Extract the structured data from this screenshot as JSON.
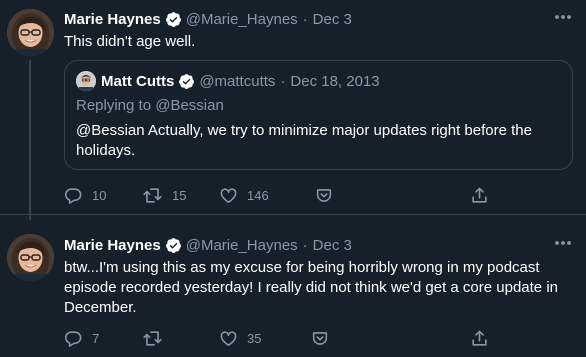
{
  "colors": {
    "background": "#15202b",
    "text": "#ffffff",
    "muted": "#8899a6",
    "border": "#38444d",
    "verified": "#ffffff"
  },
  "tweets": [
    {
      "display_name": "Marie Haynes",
      "handle": "@Marie_Haynes",
      "separator": "·",
      "date": "Dec 3",
      "text": "This didn't age well.",
      "quote": {
        "display_name": "Matt Cutts",
        "handle": "@mattcutts",
        "separator": "·",
        "date": "Dec 18, 2013",
        "replying_to": "Replying to @Bessian",
        "text": "@Bessian Actually, we try to minimize major updates right before the holidays."
      },
      "actions": {
        "reply_count": "10",
        "retweet_count": "15",
        "like_count": "146"
      }
    },
    {
      "display_name": "Marie Haynes",
      "handle": "@Marie_Haynes",
      "separator": "·",
      "date": "Dec 3",
      "text": "btw...I'm using this as my excuse for being horribly wrong in my podcast episode recorded yesterday! I really did not think we'd get a core update in December.",
      "actions": {
        "reply_count": "7",
        "like_count": "35"
      }
    }
  ],
  "icons": {
    "more": "more-horizontal-icon",
    "verified": "verified-badge-icon",
    "reply": "reply-icon",
    "retweet": "retweet-icon",
    "like": "heart-icon",
    "bookmark": "bookmark-icon",
    "share": "share-icon"
  }
}
